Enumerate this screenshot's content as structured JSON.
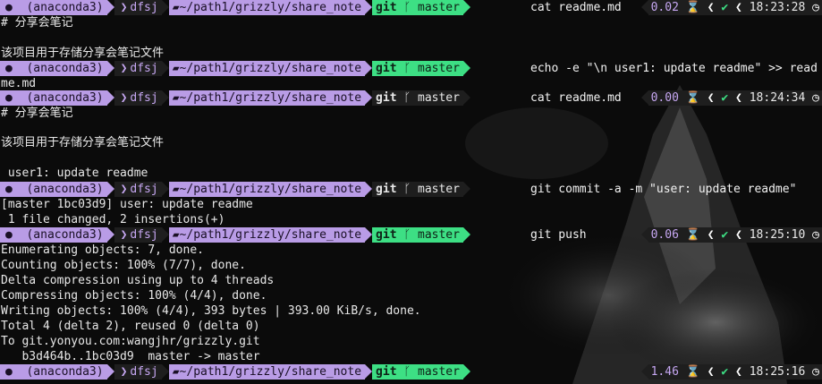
{
  "theme": {
    "accent_purple": "#b99ce6",
    "accent_green": "#3ddf84",
    "segment_dark": "#1e1e1e",
    "text": "#e8e8e8"
  },
  "prompt": {
    "env": "(anaconda3)",
    "user": "dfsj",
    "path": "~/path1/grizzly/share_note",
    "git_label": "git",
    "branch": "master",
    "icons": [
      "conda-icon",
      "apple-icon",
      "folder-icon",
      "git-branch-icon"
    ]
  },
  "lines": {
    "p1_cmd": "cat readme.md",
    "p1_dur": "0.02",
    "p1_time": "18:23:28",
    "out_title": "# 分享会笔记",
    "out_desc": "该项目用于存储分享会笔记文件",
    "p2_cmd": "echo -e \"\\n user1: update readme\" >> read",
    "p2_wrap": "me.md",
    "p3_cmd": "cat readme.md",
    "p3_dur": "0.00",
    "p3_time": "18:24:34",
    "out_title2": "# 分享会笔记",
    "out_desc2": "该项目用于存储分享会笔记文件",
    "out_user1": " user1: update readme",
    "p4_cmd": "git commit -a -m \"user: update readme\"",
    "commit_line1": "[master 1bc03d9] user: update readme",
    "commit_line2": " 1 file changed, 2 insertions(+)",
    "p5_cmd": "git push",
    "p5_dur": "0.06",
    "p5_time": "18:25:10",
    "push_1": "Enumerating objects: 7, done.",
    "push_2": "Counting objects: 100% (7/7), done.",
    "push_3": "Delta compression using up to 4 threads",
    "push_4": "Compressing objects: 100% (4/4), done.",
    "push_5": "Writing objects: 100% (4/4), 393 bytes | 393.00 KiB/s, done.",
    "push_6": "Total 4 (delta 2), reused 0 (delta 0)",
    "push_7": "To git.yonyou.com:wangjhr/grizzly.git",
    "push_8": "   b3d464b..1bc03d9  master -> master",
    "p6_dur": "1.46",
    "p6_time": "18:25:16"
  }
}
